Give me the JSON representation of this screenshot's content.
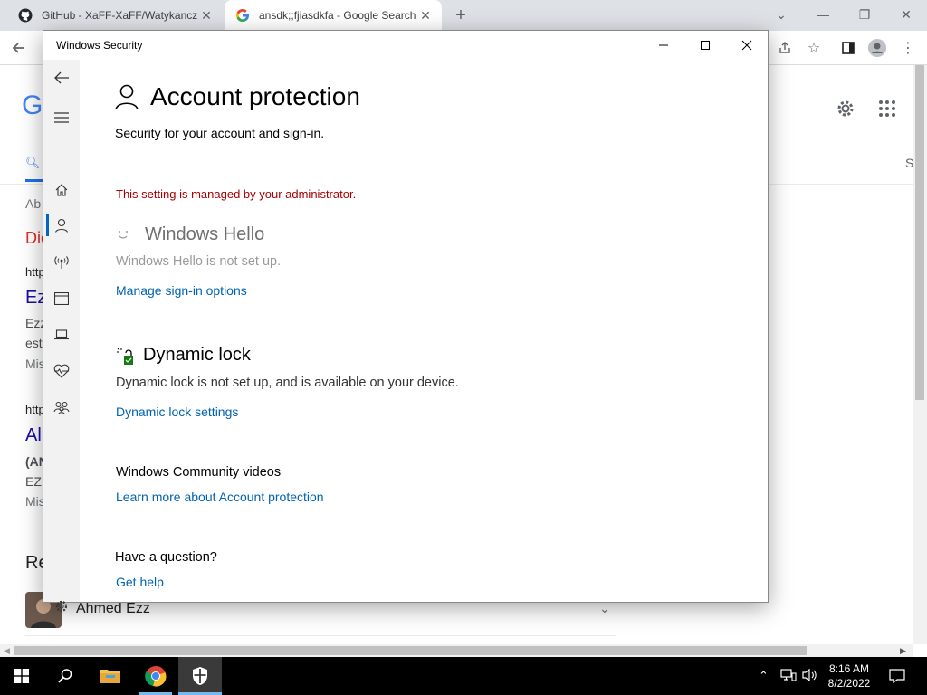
{
  "browser": {
    "tabs": [
      {
        "title": "GitHub - XaFF-XaFF/Watykanczyk",
        "close": "✕"
      },
      {
        "title": "ansdk;;fjiasdkfa - Google Search",
        "close": "✕"
      }
    ],
    "new_tab": "+"
  },
  "google": {
    "logo_partial": "G",
    "search_tab_partial": "S",
    "about_partial": "Ab",
    "result_heading_partial": "Dic",
    "url_partial_1": "http",
    "result1_title_partial": "Ez",
    "result1_line1": "Ezz",
    "result1_line2": "est",
    "result1_line3": "Mis",
    "url_partial_2": "http",
    "result2_title_partial": "Al",
    "result2_line1": "(AN",
    "result2_line2": "EZ",
    "result2_line3": "Mis",
    "related_partial": "Re",
    "person_name": "Ahmed Ezz"
  },
  "window": {
    "title": "Windows Security",
    "page_title": "Account protection",
    "page_subtitle": "Security for your account and sign-in.",
    "admin_warning": "This setting is managed by your administrator.",
    "hello": {
      "title": "Windows Hello",
      "status": "Windows Hello is not set up.",
      "link": "Manage sign-in options"
    },
    "dynamic_lock": {
      "title": "Dynamic lock",
      "status": "Dynamic lock is not set up, and is available on your device.",
      "link": "Dynamic lock settings"
    },
    "community": {
      "title": "Windows Community videos",
      "link": "Learn more about Account protection"
    },
    "question": {
      "title": "Have a question?",
      "link": "Get help"
    }
  },
  "taskbar": {
    "time": "8:16 AM",
    "date": "8/2/2022"
  },
  "colors": {
    "link": "#0063b1",
    "warning": "#a80000",
    "accent": "#0067c0",
    "google_blue": "#1a0dab",
    "google_red": "#d93025"
  }
}
